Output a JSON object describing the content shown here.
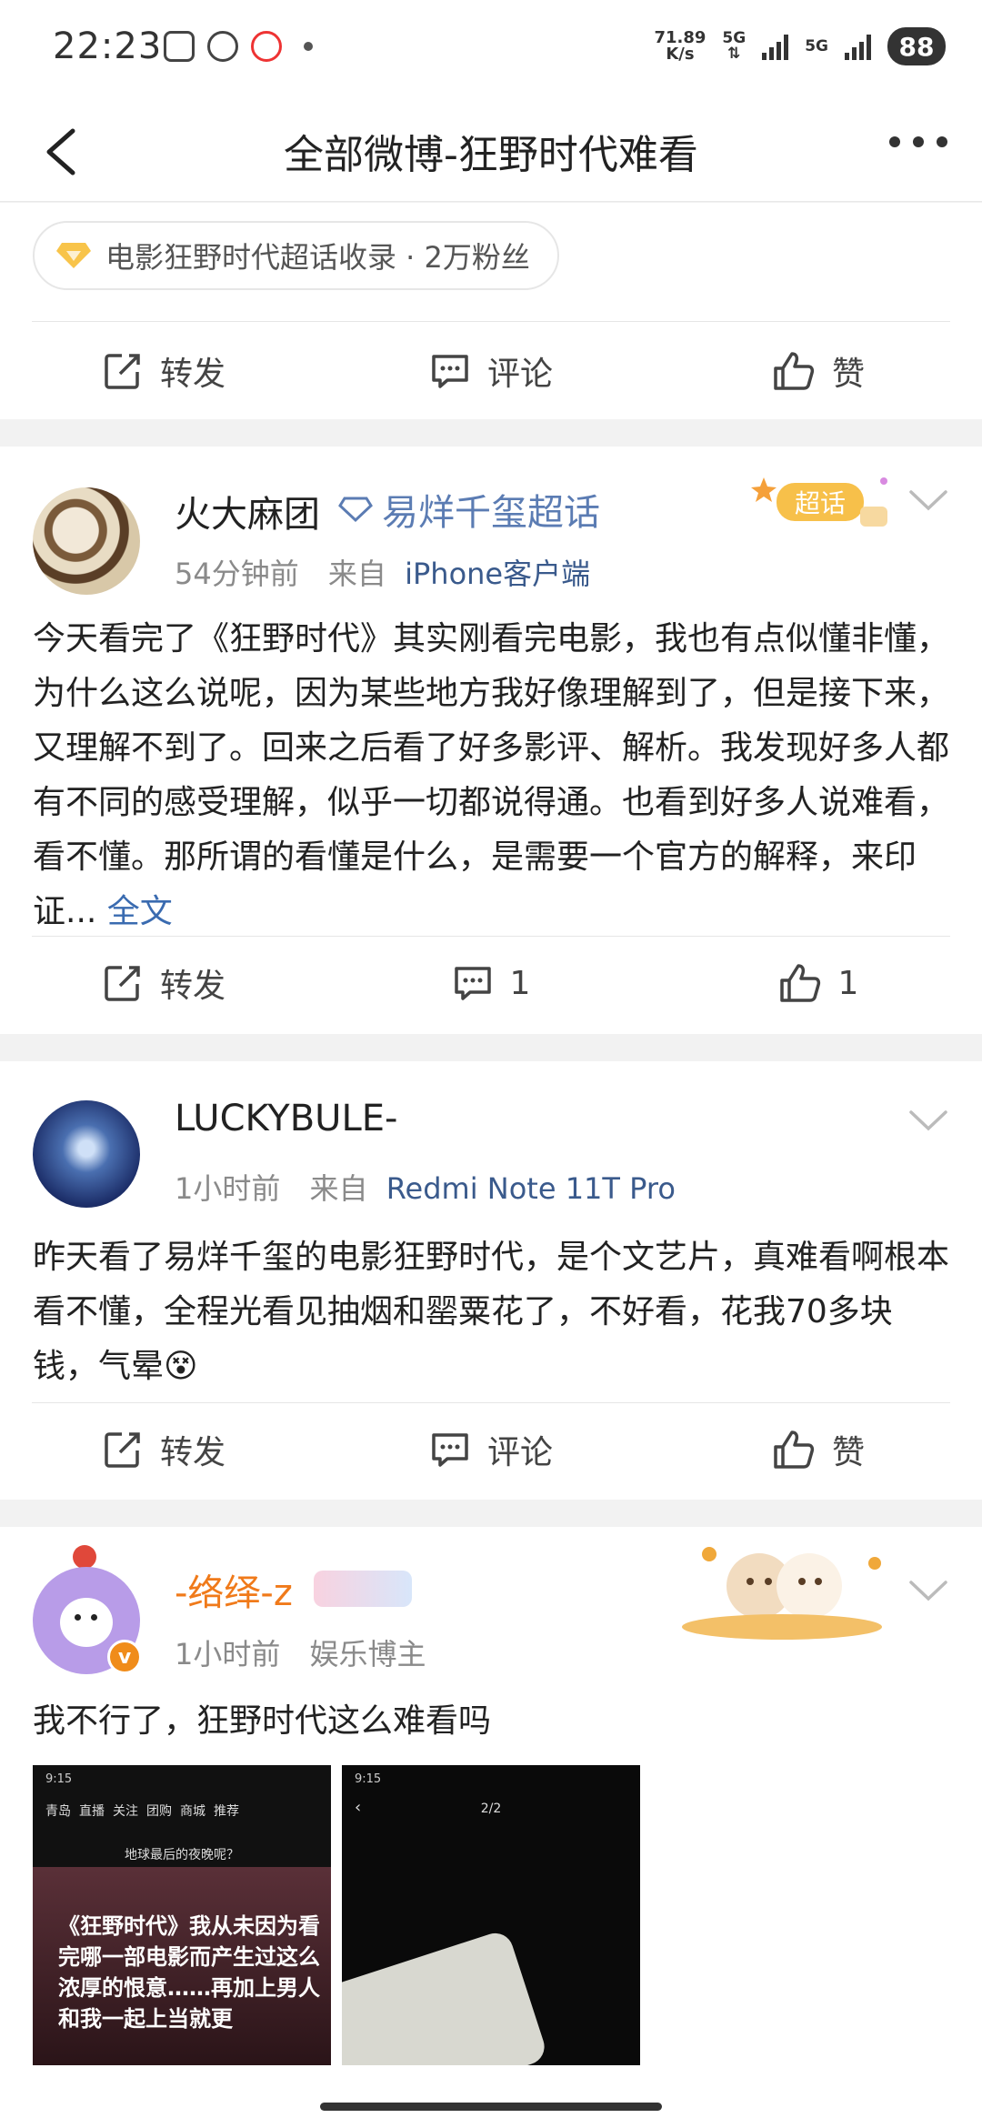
{
  "status": {
    "time": "22:23",
    "net_speed_value": "71.89",
    "net_speed_unit": "K/s",
    "sim1": "5G",
    "sim2": "5G",
    "battery": "88"
  },
  "nav": {
    "title": "全部微博-狂野时代难看"
  },
  "top_card": {
    "chip_text": "电影狂野时代超话收录 · 2万粉丝",
    "repost": "转发",
    "comment": "评论",
    "like": "赞"
  },
  "posts": [
    {
      "username": "火大麻团",
      "super_topic": "易烊千玺超话",
      "badge_text": "超话",
      "time": "54分钟前",
      "from_prefix": "来自",
      "source": "iPhone客户端",
      "text": "今天看完了《狂野时代》其实刚看完电影，我也有点似懂非懂，为什么这么说呢，因为某些地方我好像理解到了，但是接下来，又理解不到了。回来之后看了好多影评、解析。我发现好多人都有不同的感受理解，似乎一切都说得通。也看到好多人说难看，看不懂。那所谓的看懂是什么，是需要一个官方的解释，来印证...",
      "full_text_link": "全文",
      "repost": "转发",
      "comment": "1",
      "like": "1"
    },
    {
      "username": "LUCKYBULE-",
      "time": "1小时前",
      "from_prefix": "来自",
      "source": "Redmi Note 11T Pro",
      "text": "昨天看了易烊千玺的电影狂野时代，是个文艺片，真难看啊根本看不懂，全程光看见抽烟和罂粟花了，不好看，花我70多块钱，气晕",
      "emoji": "😵",
      "repost": "转发",
      "comment": "评论",
      "like": "赞"
    },
    {
      "username": "-络绎-z",
      "time": "1小时前",
      "tag": "娱乐博主",
      "text": "我不行了，狂野时代这么难看吗",
      "image1": {
        "time": "9:15",
        "tabs": [
          "青岛",
          "直播",
          "关注",
          "团购",
          "商城",
          "推荐"
        ],
        "subtitle": "地球最后的夜晚呢？",
        "caption": "《狂野时代》我从未因为看完哪一部电影而产生过这么浓厚的恨意……再加上男人和我一起上当就更"
      },
      "image2": {
        "time": "9:15",
        "page": "2/2"
      }
    }
  ],
  "colors": {
    "accent_link": "#3a6bb0",
    "source_blue": "#3a5a8c",
    "username_orange": "#f07a1a",
    "badge_gold": "#f5b04a",
    "verified_orange": "#f08c1a"
  }
}
